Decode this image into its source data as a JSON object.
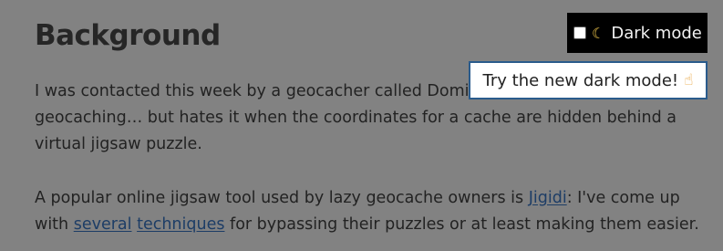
{
  "article": {
    "heading": "Background",
    "paragraph1": "I was contacted this week by a geocacher called Dominik who enjoys geocaching… but hates it when the coordinates for a cache are hidden behind a virtual jigsaw puzzle.",
    "paragraph2": {
      "text_before": "A popular online jigsaw tool used by lazy geocache owners is ",
      "link_jigidi": "Jigidi",
      "text_after_jigidi": ": I've come up with ",
      "link_several": "several",
      "space": " ",
      "link_techniques": "techniques",
      "text_end": " for bypassing their puzzles or at least making them easier."
    }
  },
  "dark_mode_toggle": {
    "label": "Dark mode",
    "checked": false,
    "icon": "moon-icon"
  },
  "tooltip": {
    "text": "Try the new dark mode!",
    "icon": "pointing-hand-icon"
  },
  "colors": {
    "overlay_background": "#828282",
    "link": "#1d3d66",
    "toggle_background": "#000000",
    "tooltip_border": "#2a5b8c"
  }
}
